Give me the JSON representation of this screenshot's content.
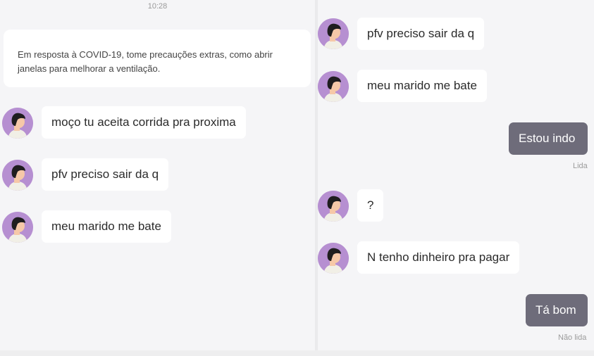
{
  "left": {
    "time": "10:28",
    "notice": "Em resposta à COVID-19, tome precauções extras, como abrir janelas para melhorar a ventilação.",
    "messages": [
      {
        "text": "moço tu aceita corrida pra proxima"
      },
      {
        "text": "pfv preciso sair da q"
      },
      {
        "text": "meu marido me bate"
      }
    ]
  },
  "right": {
    "messages": [
      {
        "text": "pfv preciso sair da q",
        "direction": "incoming"
      },
      {
        "text": "meu marido me bate",
        "direction": "incoming"
      },
      {
        "text": "Estou indo",
        "direction": "outgoing",
        "status": "Lida"
      },
      {
        "text": "?",
        "direction": "incoming"
      },
      {
        "text": "N tenho dinheiro pra pagar",
        "direction": "incoming"
      },
      {
        "text": "Tá bom",
        "direction": "outgoing",
        "status": "Não lida"
      }
    ]
  },
  "colors": {
    "avatar": "#b68fd1",
    "outgoing_bubble": "#6e6c7a",
    "incoming_bubble": "#ffffff",
    "background": "#f5f5f7"
  },
  "icons": {
    "avatar": "person-avatar-icon"
  }
}
